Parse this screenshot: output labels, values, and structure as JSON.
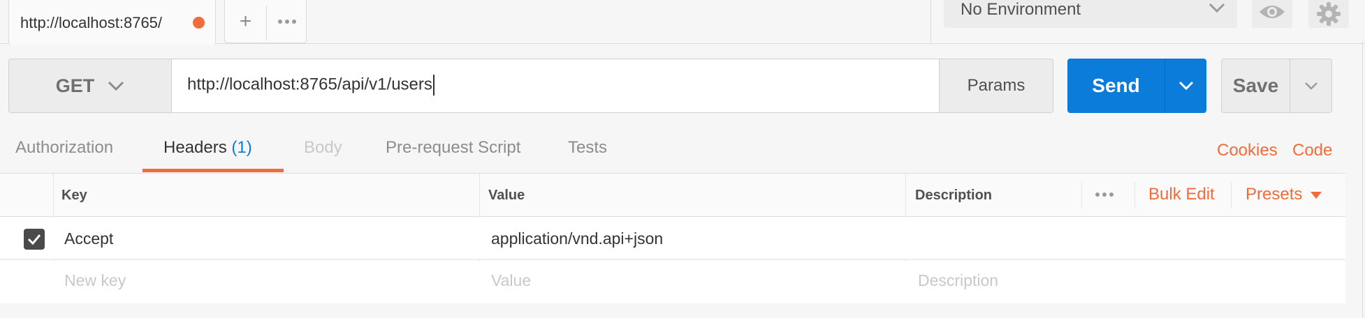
{
  "tabs": {
    "active_tab_label": "http://localhost:8765/",
    "new_tab_label": "+",
    "unsaved_color": "#f26b3a"
  },
  "environment": {
    "selected": "No Environment"
  },
  "request": {
    "method": "GET",
    "url": "http://localhost:8765/api/v1/users",
    "params_label": "Params",
    "send_label": "Send",
    "save_label": "Save"
  },
  "subtabs": {
    "authorization": "Authorization",
    "headers": "Headers",
    "headers_count": "(1)",
    "body": "Body",
    "prerequest": "Pre-request Script",
    "tests": "Tests",
    "cookies": "Cookies",
    "code": "Code"
  },
  "headers_table": {
    "columns": {
      "key": "Key",
      "value": "Value",
      "description": "Description"
    },
    "bulk_edit_label": "Bulk Edit",
    "presets_label": "Presets",
    "rows": [
      {
        "checked": true,
        "key": "Accept",
        "value": "application/vnd.api+json",
        "description": ""
      }
    ],
    "placeholders": {
      "key": "New key",
      "value": "Value",
      "description": "Description"
    }
  },
  "colors": {
    "accent_orange": "#f26b3a",
    "send_blue": "#0c7cdb"
  }
}
